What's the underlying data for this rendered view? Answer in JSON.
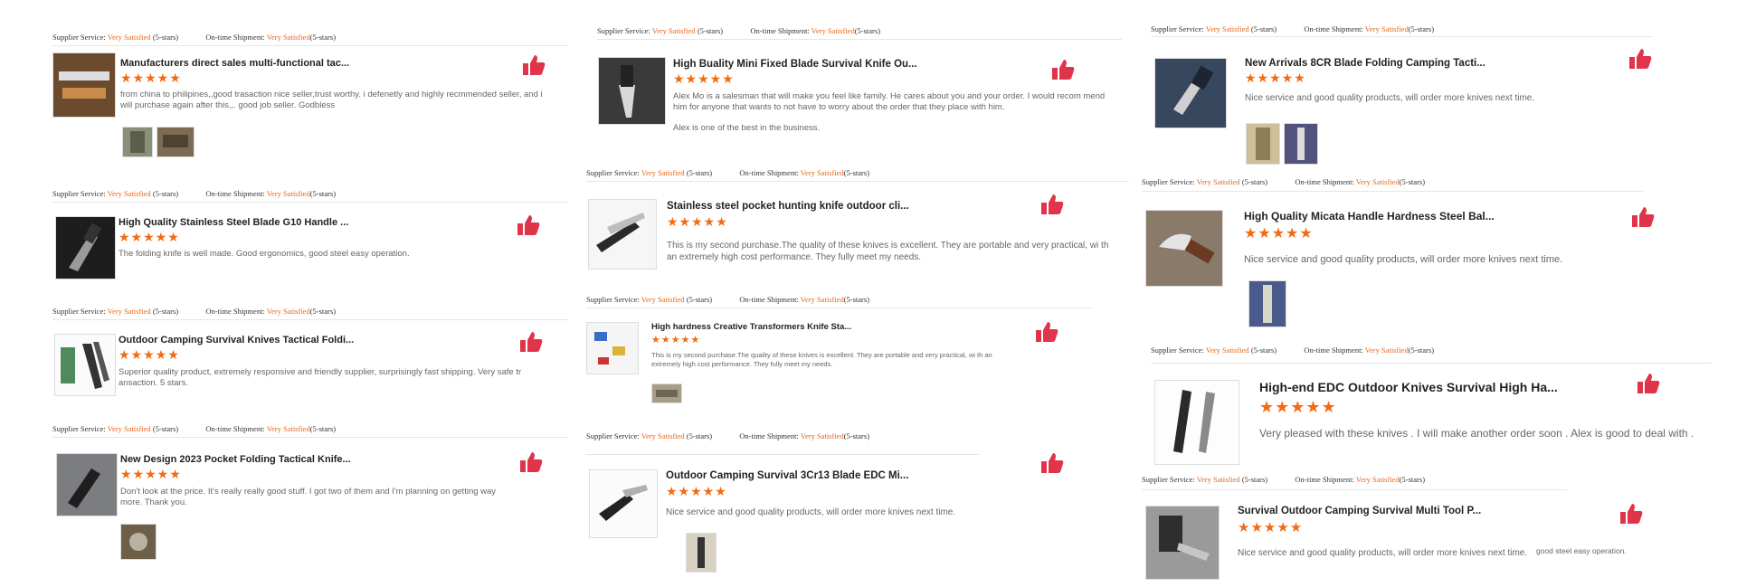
{
  "meta": {
    "supplier_label": "Supplier Service:",
    "shipment_label": "On-time Shipment:",
    "rating_value": "Very Satisfied",
    "stars_suffix": "(5-stars)"
  },
  "stars_text": "★★★★★",
  "colors": {
    "accent": "#f26b11",
    "like": "#e0344a"
  },
  "reviews": [
    {
      "title": "Manufacturers direct sales multi-functional tac...",
      "text": "from china to philipines,,good trasaction nice seller,trust worthy. i defenetly and highly recmmended seller, and i will purchase again after this,,. good job seller. Godbless"
    },
    {
      "title": "High Quality Stainless Steel Blade G10 Handle ...",
      "text": "The folding knife is well made. Good ergonomics, good steel easy operation."
    },
    {
      "title": "Outdoor Camping Survival Knives Tactical Foldi...",
      "text": "Superior quality product, extremely responsive and friendly supplier, surprisingly fast shipping.  Very safe tr ansaction. 5 stars."
    },
    {
      "title": "New Design 2023 Pocket Folding Tactical Knife...",
      "text": "Don't look at the price. It's really really good stuff. I got two of them and I'm planning on getting way more. Thank you."
    },
    {
      "title": "High Buality Mini Fixed Blade Survival Knife Ou...",
      "text": "Alex Mo is a salesman that will make you feel like family. He cares about you and your order. I would recom mend him for anyone that wants to not have to worry about the order that they place with him.",
      "text2": "Alex is one of the best in the business."
    },
    {
      "title": "Stainless steel pocket hunting knife outdoor cli...",
      "text": "This is my second purchase.The quality of these knives is excellent. They are portable and very practical, wi th an extremely high cost performance. They fully meet my needs."
    },
    {
      "title": "High hardness Creative Transformers Knife Sta...",
      "text": "This is my second purchase.The quality of these knives is excellent. They are portable and very practical, wi th an extremely high cost performance. They fully meet my needs."
    },
    {
      "title": "Outdoor Camping Survival 3Cr13 Blade EDC Mi...",
      "text": "Nice service and good quality products, will order more knives next time."
    },
    {
      "title": "New Arrivals 8CR Blade Folding Camping Tacti...",
      "text": "Nice service and good quality products, will order more knives next time."
    },
    {
      "title": "High Quality Micata Handle Hardness Steel Bal...",
      "text": "Nice service and good quality products, will order more knives next time."
    },
    {
      "title": "High-end EDC Outdoor Knives Survival High Ha...",
      "text": "Very pleased with these knives . I will make another order soon . Alex is good to deal with ."
    },
    {
      "title": "Survival Outdoor Camping Survival Multi Tool P...",
      "text": "Nice service and good quality products, will order more knives next time.",
      "text2": "good steel easy operation."
    }
  ]
}
